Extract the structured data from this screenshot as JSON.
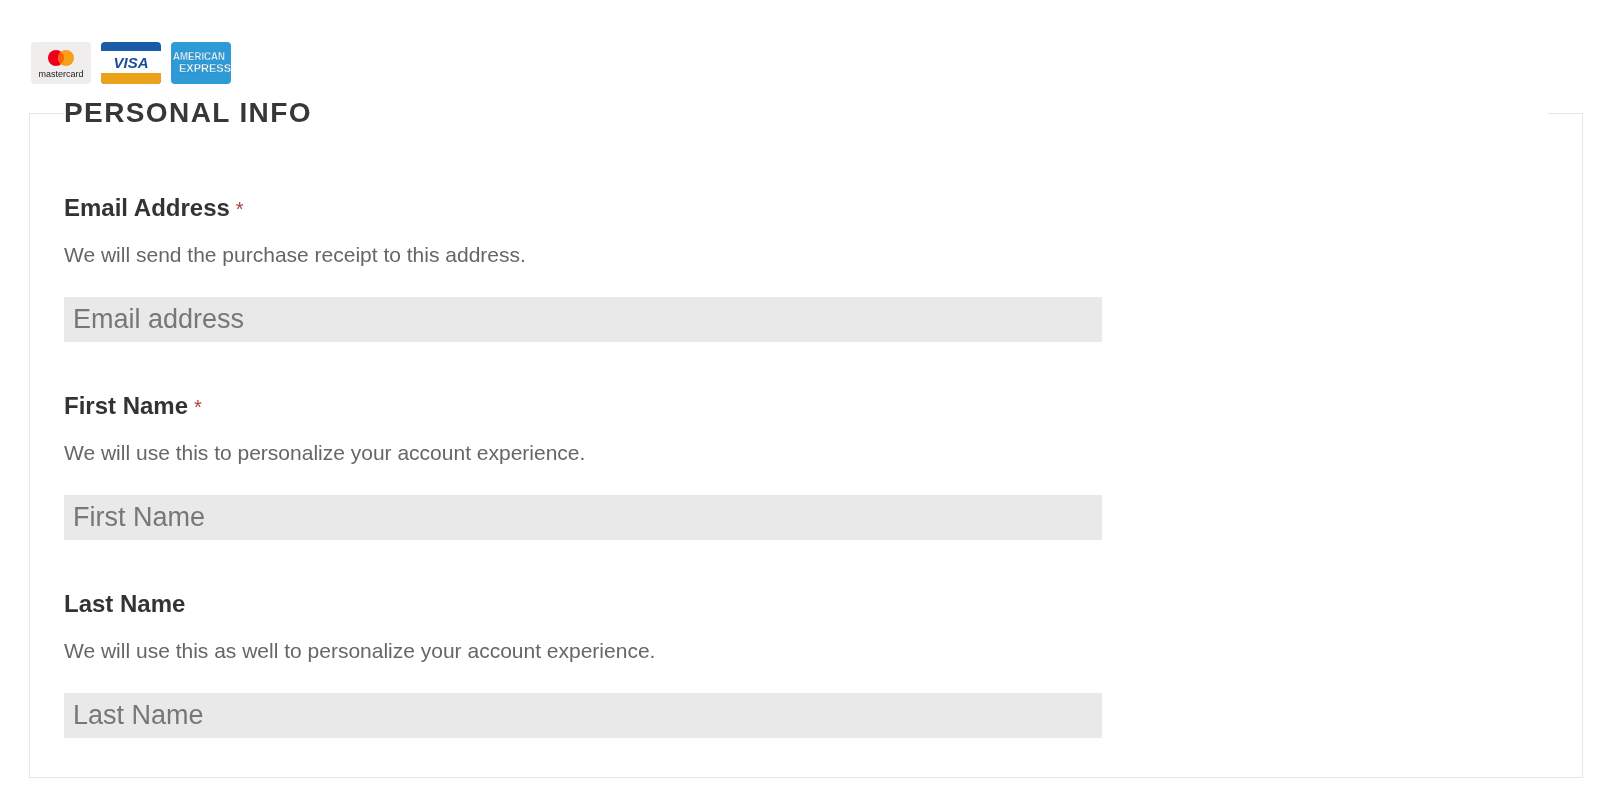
{
  "payment_logos": [
    {
      "kind": "mastercard",
      "lines": [
        "mastercard"
      ]
    },
    {
      "kind": "visa",
      "lines": [
        "VISA"
      ]
    },
    {
      "kind": "amex",
      "lines": [
        "AMERICAN",
        "EXPRESS"
      ]
    }
  ],
  "section": {
    "title": "PERSONAL INFO"
  },
  "fields": [
    {
      "label": "Email Address",
      "required_mark": "*",
      "description": "We will send the purchase receipt to this address.",
      "placeholder": "Email address"
    },
    {
      "label": "First Name",
      "required_mark": "*",
      "description": "We will use this to personalize your account experience.",
      "placeholder": "First Name"
    },
    {
      "label": "Last Name",
      "description": "We will use this as well to personalize your account experience.",
      "placeholder": "Last Name"
    }
  ]
}
